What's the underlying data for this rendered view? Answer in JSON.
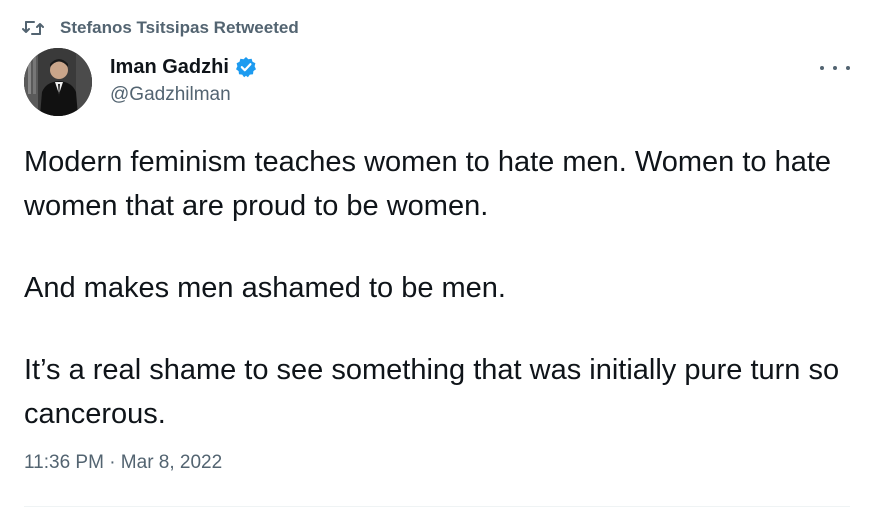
{
  "retweet": {
    "icon": "retweet-icon",
    "label": "Stefanos Tsitsipas Retweeted"
  },
  "author": {
    "display_name": "Iman Gadzhi",
    "handle": "@Gadzhilman",
    "verified": true,
    "verified_color": "#1d9bf0",
    "avatar_icon": "avatar"
  },
  "tweet": {
    "paragraphs": [
      "Modern feminism teaches women to hate men. Women to hate women that are proud to be women.",
      "And makes men ashamed to be men.",
      "It’s a real shame to see something that was initially pure turn so cancerous."
    ],
    "timestamp": "11:36 PM · Mar 8, 2022"
  },
  "colors": {
    "text": "#0f1419",
    "secondary": "#536471",
    "divider": "#eff3f4"
  }
}
